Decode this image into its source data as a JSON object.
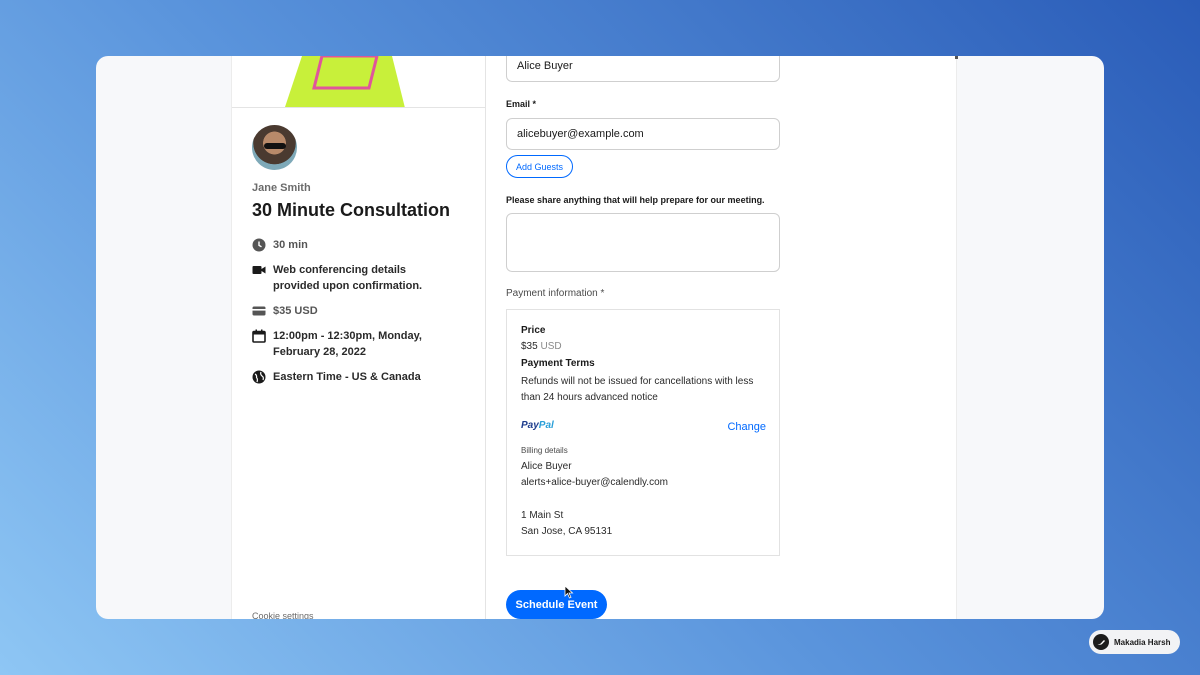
{
  "sidebar": {
    "host_name": "Jane Smith",
    "event_title": "30 Minute Consultation",
    "duration": "30 min",
    "location": "Web conferencing details provided upon confirmation.",
    "price": "$35 USD",
    "datetime": "12:00pm - 12:30pm, Monday, February 28, 2022",
    "timezone": "Eastern Time - US & Canada",
    "cookie_settings": "Cookie settings",
    "icons": [
      "clock-icon",
      "video-camera-icon",
      "credit-card-icon",
      "calendar-icon",
      "globe-icon"
    ]
  },
  "form": {
    "name_value": "Alice Buyer",
    "email_label": "Email *",
    "email_value": "alicebuyer@example.com",
    "add_guests_label": "Add Guests",
    "notes_label": "Please share anything that will help prepare for our meeting.",
    "notes_value": "",
    "payment_label": "Payment information *",
    "schedule_label": "Schedule Event"
  },
  "payment": {
    "price_heading": "Price",
    "price_amount": "$35",
    "price_currency": "USD",
    "terms_heading": "Payment Terms",
    "terms_text": "Refunds will not be issued for cancellations with less than 24 hours advanced notice",
    "provider_pay": "Pay",
    "provider_pal": "Pal",
    "change_label": "Change",
    "billing_heading": "Billing details",
    "billing_name": "Alice Buyer",
    "billing_email": "alerts+alice-buyer@calendly.com",
    "address_line1": "1 Main St",
    "address_line2": "San Jose, CA 95131"
  },
  "badge": {
    "author": "Makadia Harsh"
  },
  "colors": {
    "accent": "#0069ff",
    "logo_green": "#c8f03a",
    "logo_pink": "#e0559b"
  }
}
